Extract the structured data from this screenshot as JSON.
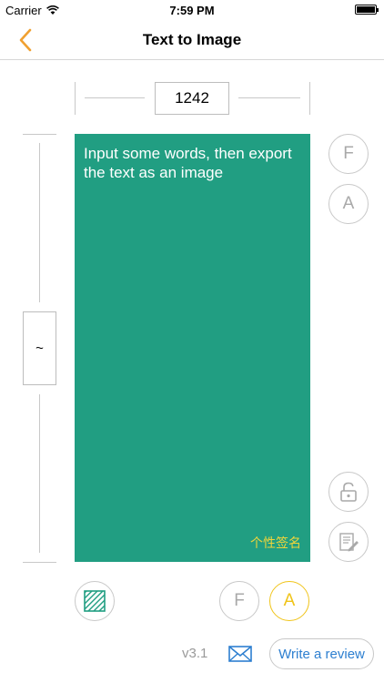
{
  "status_bar": {
    "carrier": "Carrier",
    "time": "7:59 PM"
  },
  "nav": {
    "title": "Text to Image",
    "back_icon": "chevron-left-icon"
  },
  "canvas": {
    "width_value": "1242",
    "height_value": "~",
    "text": "Input some words, then export the text as an image",
    "signature": "个性签名",
    "background_color": "#219e82",
    "text_color": "#ffffff",
    "signature_color": "#f0d53a"
  },
  "side_controls": {
    "font_button": "F",
    "align_button": "A",
    "lock_icon": "unlock-icon",
    "edit_icon": "document-edit-icon"
  },
  "bottom_controls": {
    "pattern_icon": "hatch-pattern-icon",
    "font_button": "F",
    "align_button": "A"
  },
  "footer": {
    "version": "v3.1",
    "mail_icon": "mail-icon",
    "review_label": "Write a review"
  },
  "colors": {
    "accent": "#f0a030",
    "active": "#f0c419",
    "link": "#2d7fd0"
  }
}
